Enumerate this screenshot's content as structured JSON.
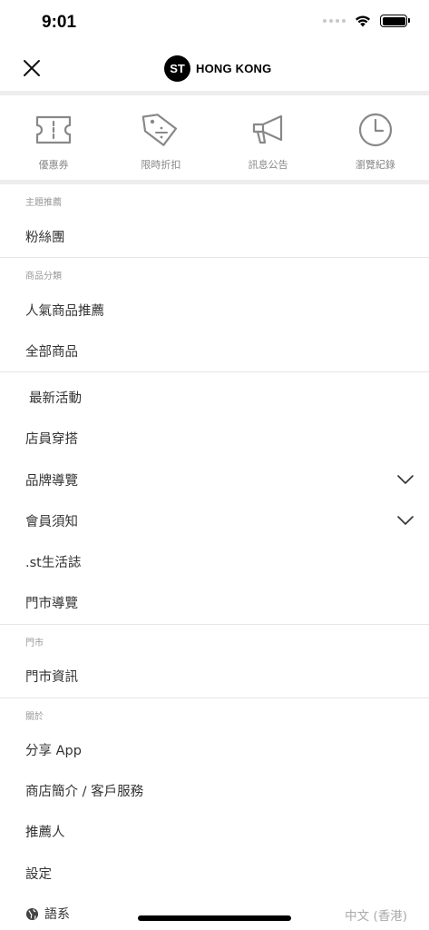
{
  "status": {
    "time": "9:01"
  },
  "brand": {
    "logo_text": "ST",
    "name": "HONG KONG"
  },
  "quick_links": [
    {
      "label": "優惠券",
      "icon": "ticket-icon"
    },
    {
      "label": "限時折扣",
      "icon": "discount-tag-icon"
    },
    {
      "label": "訊息公告",
      "icon": "megaphone-icon"
    },
    {
      "label": "瀏覽紀錄",
      "icon": "clock-icon"
    }
  ],
  "sections": {
    "themes": {
      "title": "主題推薦",
      "items": [
        "粉絲團"
      ]
    },
    "categories": {
      "title": "商品分類",
      "items": [
        "人氣商品推薦",
        "全部商品"
      ]
    },
    "general": {
      "items": [
        "最新活動",
        "店員穿搭",
        "品牌導覽",
        "會員須知",
        ".st生活誌",
        "門市導覽"
      ]
    },
    "store": {
      "title": "門市",
      "items": [
        "門市資訊"
      ]
    },
    "about": {
      "title": "關於",
      "items": [
        "分享 App",
        "商店簡介 / 客戶服務",
        "推薦人",
        "設定"
      ]
    }
  },
  "language": {
    "label": "語系",
    "value": "中文 (香港)"
  },
  "colors": {
    "accent": "#000000",
    "text": "#333333",
    "muted": "#999999",
    "separator": "#ededed"
  }
}
